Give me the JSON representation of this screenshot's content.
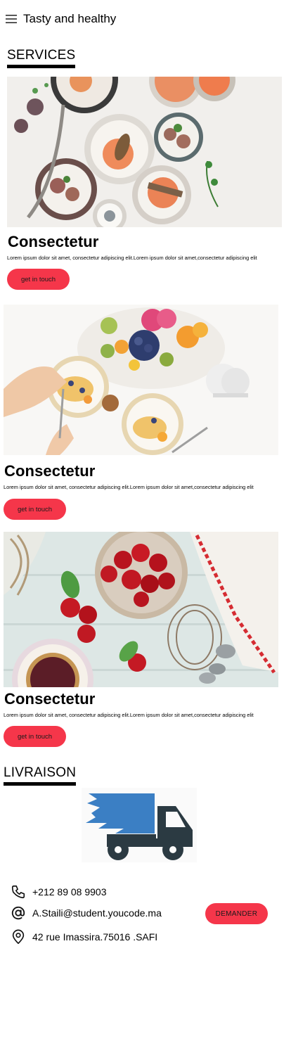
{
  "header": {
    "brand": "Tasty and healthy",
    "menu_icon": "hamburger-menu-icon"
  },
  "services": {
    "title": "SERVICES",
    "cards": [
      {
        "title": "Consectetur",
        "text": "Lorem ipsum dolor sit amet, consectetur adipiscing elit.Lorem ipsum dolor sit amet,consectetur adipiscing elit",
        "button": "get in touch"
      },
      {
        "title": "Consectetur",
        "text": "Lorem ipsum dolor sit amet, consectetur adipiscing elit.Lorem ipsum dolor sit amet,consectetur adipiscing elit",
        "button": "get in touch"
      },
      {
        "title": "Consectetur",
        "text": "Lorem ipsum dolor sit amet, consectetur adipiscing elit.Lorem ipsum dolor sit amet,consectetur adipiscing elit",
        "button": "get in touch"
      }
    ]
  },
  "livraison": {
    "title": "LIVRAISON",
    "truck_icon": "delivery-truck-icon",
    "phone": "+212 89 08 9903",
    "email": "A.Staili@student.youcode.ma",
    "address": "42 rue Imassira.75016 .SAFI",
    "button": "DEMANDER"
  },
  "colors": {
    "accent": "#f5364a",
    "truck_blue": "#3b7fc4",
    "truck_dark": "#2b3a42"
  }
}
